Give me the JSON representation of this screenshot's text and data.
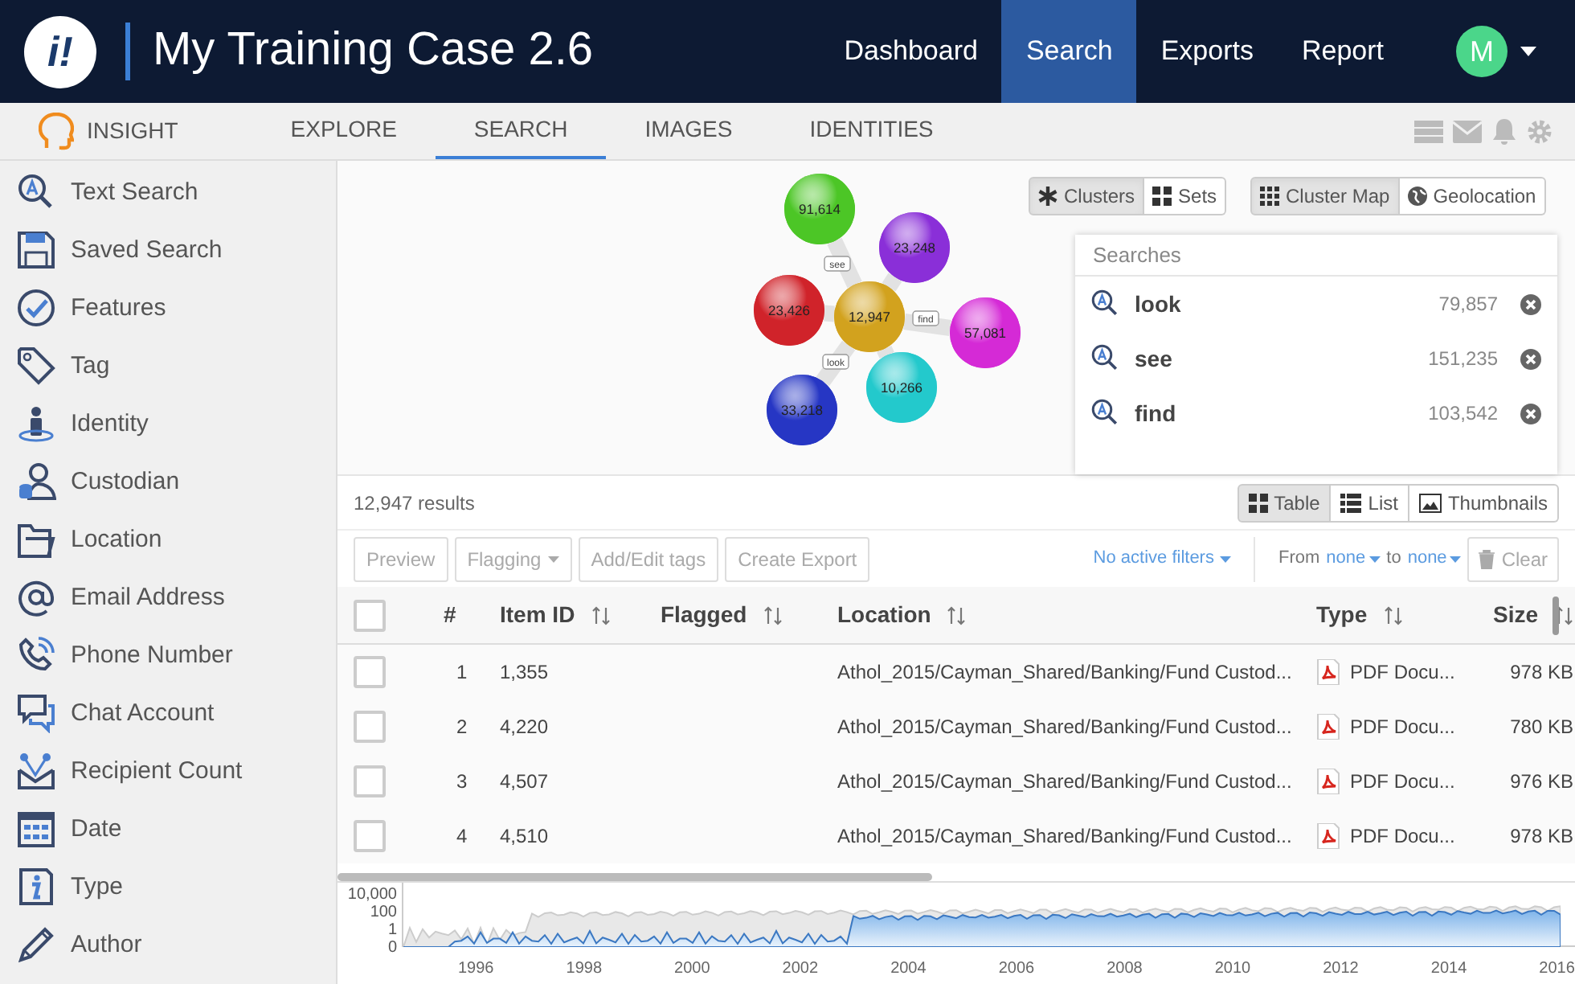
{
  "header": {
    "logo": "i!",
    "title": "My Training Case 2.6",
    "nav": [
      {
        "label": "Dashboard",
        "selected": false
      },
      {
        "label": "Search",
        "selected": true
      },
      {
        "label": "Exports",
        "selected": false
      },
      {
        "label": "Report",
        "selected": false
      }
    ],
    "avatar": "M"
  },
  "subnav": [
    {
      "label": "INSIGHT",
      "kind": "brand",
      "selected": false
    },
    {
      "label": "EXPLORE",
      "kind": "tab",
      "selected": false
    },
    {
      "label": "SEARCH",
      "kind": "tab",
      "selected": true
    },
    {
      "label": "IMAGES",
      "kind": "tab",
      "selected": false
    },
    {
      "label": "IDENTITIES",
      "kind": "tab",
      "selected": false
    }
  ],
  "sidebar": {
    "items": [
      {
        "label": "Text Search"
      },
      {
        "label": "Saved Search"
      },
      {
        "label": "Features"
      },
      {
        "label": "Tag"
      },
      {
        "label": "Identity"
      },
      {
        "label": "Custodian"
      },
      {
        "label": "Location"
      },
      {
        "label": "Email Address"
      },
      {
        "label": "Phone Number"
      },
      {
        "label": "Chat Account"
      },
      {
        "label": "Recipient Count"
      },
      {
        "label": "Date"
      },
      {
        "label": "Type"
      },
      {
        "label": "Author"
      }
    ]
  },
  "clusters": {
    "bubbles": [
      {
        "value": "91,614",
        "color": "#4cc626"
      },
      {
        "value": "23,248",
        "color": "#8a2fd8"
      },
      {
        "value": "23,426",
        "color": "#d0232a"
      },
      {
        "value": "12,947",
        "color": "#d2a21e"
      },
      {
        "value": "57,081",
        "color": "#d52ad6"
      },
      {
        "value": "10,266",
        "color": "#23c9cc"
      },
      {
        "value": "33,218",
        "color": "#2636c4"
      }
    ],
    "edge_labels": [
      "see",
      "find",
      "look"
    ]
  },
  "view_toggles": [
    {
      "label": "Clusters",
      "selected": true
    },
    {
      "label": "Sets",
      "selected": false
    }
  ],
  "map_toggles": [
    {
      "label": "Cluster Map",
      "selected": true
    },
    {
      "label": "Geolocation",
      "selected": false
    }
  ],
  "searches_panel": {
    "title": "Searches",
    "items": [
      {
        "term": "look",
        "count": "79,857"
      },
      {
        "term": "see",
        "count": "151,235"
      },
      {
        "term": "find",
        "count": "103,542"
      }
    ]
  },
  "results": {
    "count": "12,947 results",
    "layouts": [
      {
        "label": "Table",
        "selected": true
      },
      {
        "label": "List",
        "selected": false
      },
      {
        "label": "Thumbnails",
        "selected": false
      }
    ]
  },
  "toolbar": {
    "buttons": [
      {
        "label": "Preview",
        "kind": "plain",
        "disabled": true
      },
      {
        "label": "Flagging",
        "kind": "dropdown",
        "disabled": true
      },
      {
        "label": "Add/Edit tags",
        "kind": "plain",
        "disabled": true
      },
      {
        "label": "Create Export",
        "kind": "plain",
        "disabled": true
      }
    ],
    "filters": "No active filters",
    "from_label": "From",
    "from_value": "none",
    "to_label": "to",
    "to_value": "none",
    "clear": "Clear"
  },
  "table": {
    "select_all": {
      "checked": false
    },
    "columns": [
      {
        "label": "#",
        "sortable": false
      },
      {
        "label": "Item ID",
        "sortable": true
      },
      {
        "label": "Flagged",
        "sortable": true
      },
      {
        "label": "Location",
        "sortable": true
      },
      {
        "label": "Type",
        "sortable": true
      },
      {
        "label": "Size",
        "sortable": true
      }
    ],
    "rows": [
      {
        "checked": false,
        "number": "1",
        "item_id": "1,355",
        "location": "Athol_2015/Cayman_Shared/Banking/Fund Custod...",
        "type": "PDF Docu...",
        "size": "978 KB"
      },
      {
        "checked": false,
        "number": "2",
        "item_id": "4,220",
        "location": "Athol_2015/Cayman_Shared/Banking/Fund Custod...",
        "type": "PDF Docu...",
        "size": "780 KB"
      },
      {
        "checked": false,
        "number": "3",
        "item_id": "4,507",
        "location": "Athol_2015/Cayman_Shared/Banking/Fund Custod...",
        "type": "PDF Docu...",
        "size": "976 KB"
      },
      {
        "checked": false,
        "number": "4",
        "item_id": "4,510",
        "location": "Athol_2015/Cayman_Shared/Banking/Fund Custod...",
        "type": "PDF Docu...",
        "size": "978 KB"
      }
    ]
  },
  "timeline": {
    "y_labels": [
      "10,000",
      "100",
      "1",
      "0"
    ],
    "x_labels": [
      "1996",
      "1998",
      "2000",
      "2002",
      "2004",
      "2006",
      "2008",
      "2010",
      "2012",
      "2014",
      "2016"
    ]
  }
}
